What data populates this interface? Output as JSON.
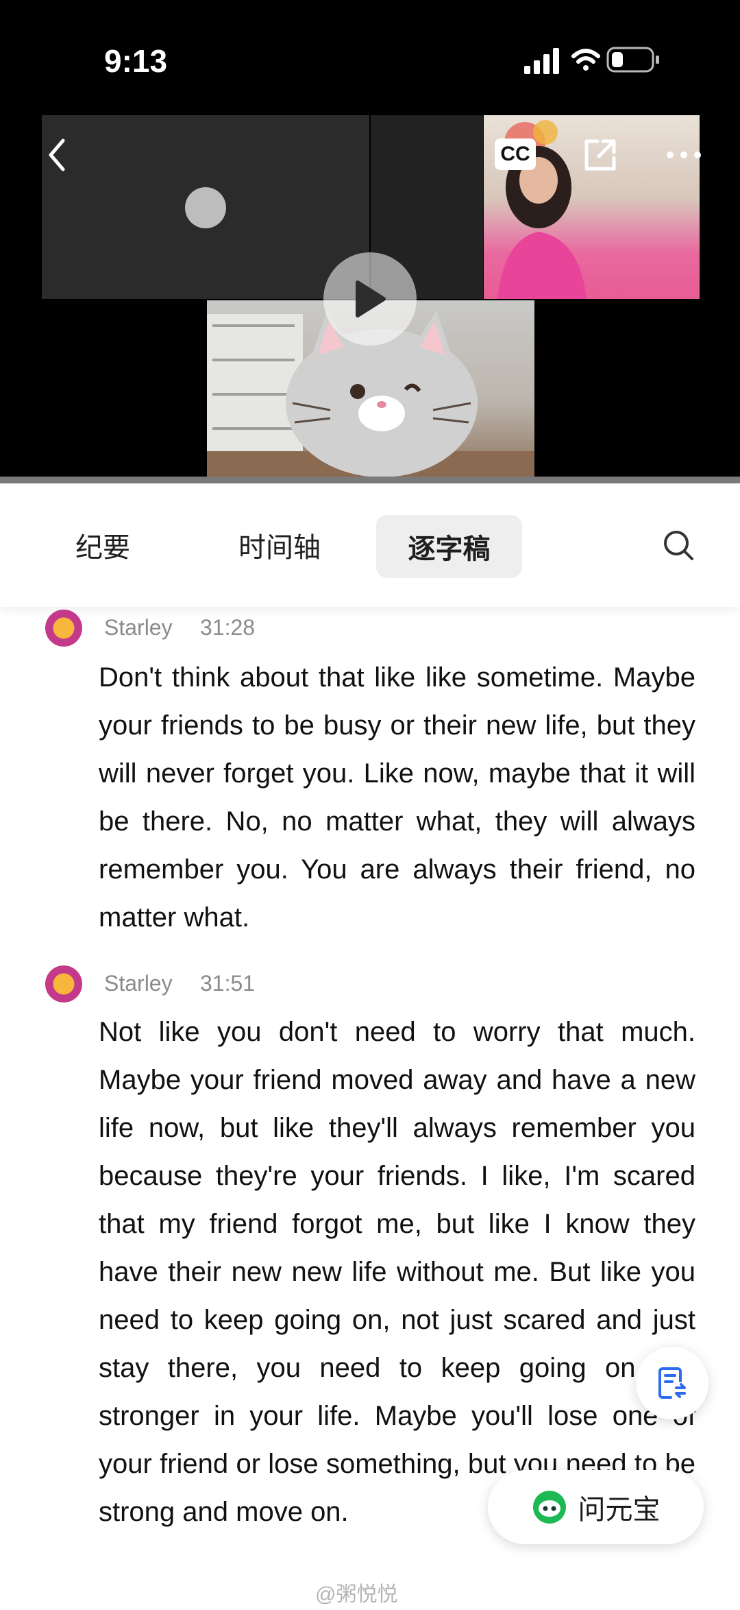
{
  "status_bar": {
    "time": "9:13"
  },
  "video": {
    "cc_label": "CC"
  },
  "tabs": [
    {
      "label": "纪要"
    },
    {
      "label": "时间轴"
    },
    {
      "label": "逐字稿",
      "active": true
    }
  ],
  "transcript": [
    {
      "speaker": "Starley",
      "time": "31:28",
      "text": "Don't think about that like like sometime. Maybe your friends to be busy or their new life, but they will never forget you. Like now, maybe that it will be there. No, no matter what, they will always remember you. You are always their friend, no matter what."
    },
    {
      "speaker": "Starley",
      "time": "31:51",
      "text": "Not like you don't need to worry that much. Maybe your friend moved away and have a new life now, but like they'll always remember you because they're your friends. I like, I'm scared that my friend forgot me, but like I know they have their new new life without me. But like you need to keep going on, not just scared and just stay there, you need to keep going on like stronger in your life. Maybe you'll lose one of your friend or lose something, but you need to be strong and move on."
    }
  ],
  "assistant_button": {
    "label": "问元宝"
  },
  "watermark": "@粥悦悦"
}
